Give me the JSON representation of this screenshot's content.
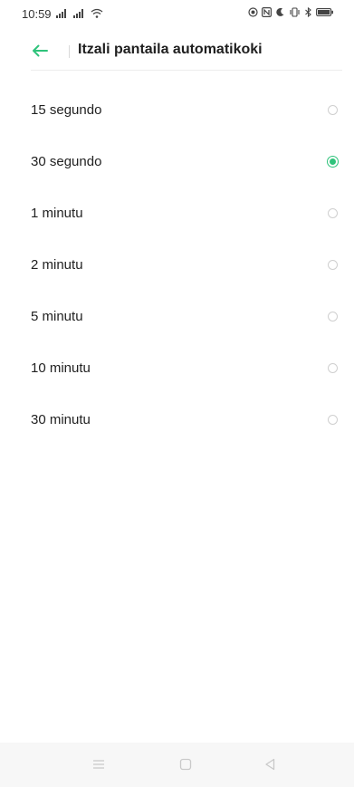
{
  "status_bar": {
    "time": "10:59",
    "icons": [
      "signal-icon",
      "signal-icon",
      "wifi-icon",
      "location-icon",
      "nfc-icon",
      "moon-icon",
      "vibrate-icon",
      "bluetooth-icon",
      "battery-icon"
    ]
  },
  "header": {
    "title": "Itzali pantaila automatikoki",
    "back_icon": "arrow-left-icon",
    "accent_color": "#2fc37b"
  },
  "options": [
    {
      "label": "15 segundo",
      "selected": false
    },
    {
      "label": "30 segundo",
      "selected": true
    },
    {
      "label": "1 minutu",
      "selected": false
    },
    {
      "label": "2 minutu",
      "selected": false
    },
    {
      "label": "5 minutu",
      "selected": false
    },
    {
      "label": "10 minutu",
      "selected": false
    },
    {
      "label": "30 minutu",
      "selected": false
    }
  ],
  "nav_bar": {
    "buttons": [
      "menu-icon",
      "home-icon",
      "back-triangle-icon"
    ]
  }
}
